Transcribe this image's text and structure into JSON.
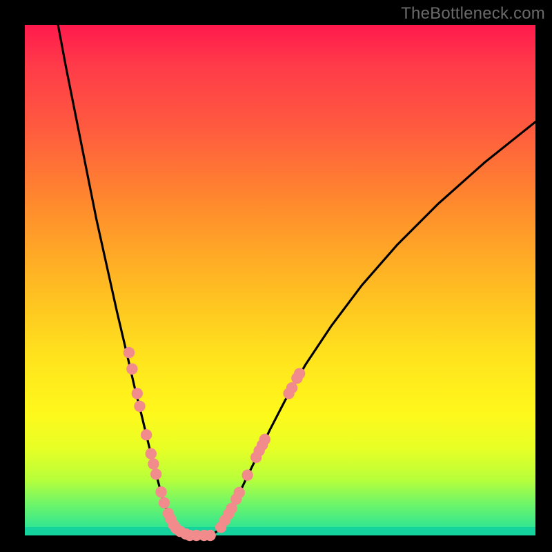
{
  "watermark": "TheBottleneck.com",
  "colors": {
    "curve_stroke": "#000000",
    "dot_fill": "#f28c8c",
    "dot_stroke": "#d96a6a"
  },
  "chart_data": {
    "type": "line",
    "title": "",
    "xlabel": "",
    "ylabel": "",
    "xlim": [
      0,
      100
    ],
    "ylim": [
      0,
      100
    ],
    "series": [
      {
        "name": "curve",
        "x_left": [
          6.5,
          8,
          10,
          12,
          14,
          16,
          18,
          20,
          21.5,
          23,
          24.2,
          25.3,
          26.3,
          27.1,
          27.8,
          28.4,
          29,
          29.7,
          30.5,
          31.5,
          33
        ],
        "y_left": [
          100,
          92,
          82,
          72,
          62,
          53,
          44,
          35.5,
          29,
          23,
          18,
          13.5,
          9.8,
          7,
          5,
          3.5,
          2.4,
          1.5,
          0.8,
          0.3,
          0
        ],
        "x_right": [
          36.5,
          37.6,
          38.7,
          40,
          41.5,
          43.3,
          45.5,
          48,
          51,
          55,
          60,
          66,
          73,
          81,
          90,
          100
        ],
        "y_right": [
          0,
          0.8,
          2.2,
          4.3,
          7.2,
          11,
          15.5,
          20.7,
          26.5,
          33.5,
          41,
          49,
          57,
          65,
          73,
          81
        ]
      }
    ],
    "dots": {
      "left": [
        {
          "x": 20.4,
          "y": 35.8
        },
        {
          "x": 21.0,
          "y": 32.6
        },
        {
          "x": 22.0,
          "y": 27.8
        },
        {
          "x": 22.5,
          "y": 25.3
        },
        {
          "x": 23.8,
          "y": 19.7
        },
        {
          "x": 24.7,
          "y": 16.0
        },
        {
          "x": 25.2,
          "y": 14.0
        },
        {
          "x": 25.7,
          "y": 12.0
        },
        {
          "x": 26.7,
          "y": 8.5
        },
        {
          "x": 27.3,
          "y": 6.4
        },
        {
          "x": 28.1,
          "y": 4.3
        },
        {
          "x": 28.5,
          "y": 3.3
        },
        {
          "x": 29.1,
          "y": 2.1
        },
        {
          "x": 29.6,
          "y": 1.4
        },
        {
          "x": 30.4,
          "y": 0.8
        },
        {
          "x": 31.5,
          "y": 0.3
        }
      ],
      "right": [
        {
          "x": 38.4,
          "y": 1.6
        },
        {
          "x": 39.2,
          "y": 3.0
        },
        {
          "x": 39.9,
          "y": 4.2
        },
        {
          "x": 40.5,
          "y": 5.3
        },
        {
          "x": 41.4,
          "y": 7.1
        },
        {
          "x": 42.0,
          "y": 8.4
        },
        {
          "x": 43.6,
          "y": 11.8
        },
        {
          "x": 45.3,
          "y": 15.3
        },
        {
          "x": 45.9,
          "y": 16.6
        },
        {
          "x": 46.5,
          "y": 17.7
        },
        {
          "x": 47.0,
          "y": 18.8
        },
        {
          "x": 51.7,
          "y": 27.8
        },
        {
          "x": 52.3,
          "y": 28.9
        },
        {
          "x": 53.3,
          "y": 30.8
        },
        {
          "x": 53.8,
          "y": 31.7
        }
      ],
      "flat": [
        {
          "x": 32.3,
          "y": 0.0
        },
        {
          "x": 33.6,
          "y": 0.0
        },
        {
          "x": 35.1,
          "y": 0.0
        },
        {
          "x": 36.3,
          "y": 0.0
        }
      ]
    }
  }
}
